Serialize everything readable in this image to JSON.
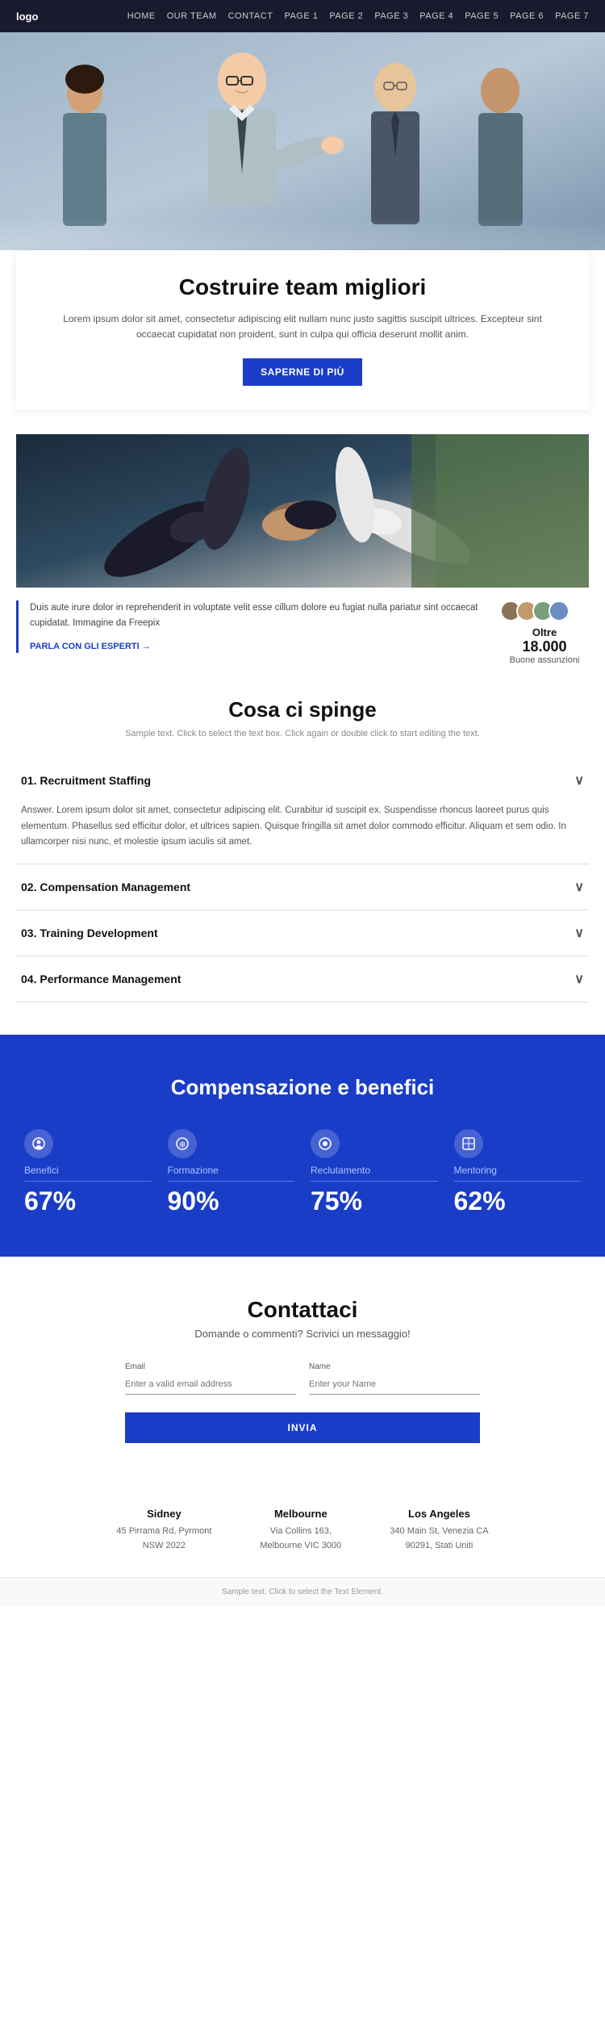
{
  "nav": {
    "logo": "logo",
    "links": [
      "HOME",
      "OUR TEAM",
      "CONTACT",
      "PAGE 1",
      "PAGE 2",
      "PAGE 3",
      "PAGE 4",
      "PAGE 5",
      "PAGE 6",
      "PAGE 7"
    ]
  },
  "hero": {
    "title": "Costruire team migliori",
    "description": "Lorem ipsum dolor sit amet, consectetur adipiscing elit nullam nunc justo sagittis suscipit ultrices. Excepteur sint occaecat cupidatat non proident, sunt in culpa qui officia deserunt mollit anim.",
    "cta_label": "SAPERNE DI PIÙ"
  },
  "team_section": {
    "body_text": "Duis aute irure dolor in reprehenderit in voluptate velit esse cillum dolore eu fugiat nulla pariatur sint occaecat cupidatat. Immagine da Freepix",
    "link_label": "PARLA CON GLI ESPERTI →",
    "stats_oltre": "Oltre",
    "stats_num": "18.000",
    "stats_label": "Buone assunzioni"
  },
  "accordion": {
    "title": "Cosa ci spinge",
    "subtitle": "Sample text. Click to select the text box. Click again or double click to start editing the text.",
    "items": [
      {
        "num": "01.",
        "label": "Recruitment Staffing",
        "body": "Answer. Lorem ipsum dolor sit amet, consectetur adipiscing elit. Curabitur id suscipit ex. Suspendisse rhoncus laoreet purus quis elementum. Phasellus sed efficitur dolor, et ultrices sapien. Quisque fringilla sit amet dolor commodo efficitur. Aliquam et sem odio. In ullamcorper nisi nunc, et molestie ipsum iaculis sit amet.",
        "open": true
      },
      {
        "num": "02.",
        "label": "Compensation Management",
        "body": "",
        "open": false
      },
      {
        "num": "03.",
        "label": "Training Development",
        "body": "",
        "open": false
      },
      {
        "num": "04.",
        "label": "Performance Management",
        "body": "",
        "open": false
      }
    ]
  },
  "benefits": {
    "title": "Compensazione e benefici",
    "items": [
      {
        "icon": "♥",
        "label": "Benefici",
        "pct": "67%"
      },
      {
        "icon": "⊕",
        "label": "Formazione",
        "pct": "90%"
      },
      {
        "icon": "◉",
        "label": "Reclutamento",
        "pct": "75%"
      },
      {
        "icon": "⊞",
        "label": "Mentoring",
        "pct": "62%"
      }
    ]
  },
  "contact": {
    "title": "Contattaci",
    "subtitle": "Domande o commenti? Scrivici un messaggio!",
    "email_label": "Email",
    "email_placeholder": "Enter a valid email address",
    "name_label": "Name",
    "name_placeholder": "Enter your Name",
    "submit_label": "INVIA"
  },
  "offices": [
    {
      "city": "Sidney",
      "address": "45 Pirrama Rd, Pyrmont",
      "state": "NSW 2022"
    },
    {
      "city": "Melbourne",
      "address": "Via Collins 163,",
      "state": "Melbourne VIC 3000"
    },
    {
      "city": "Los Angeles",
      "address": "340 Main St, Venezia CA",
      "state": "90291, Stati Uniti"
    }
  ],
  "footer": {
    "note": "Sample text. Click to select the Text Element."
  }
}
